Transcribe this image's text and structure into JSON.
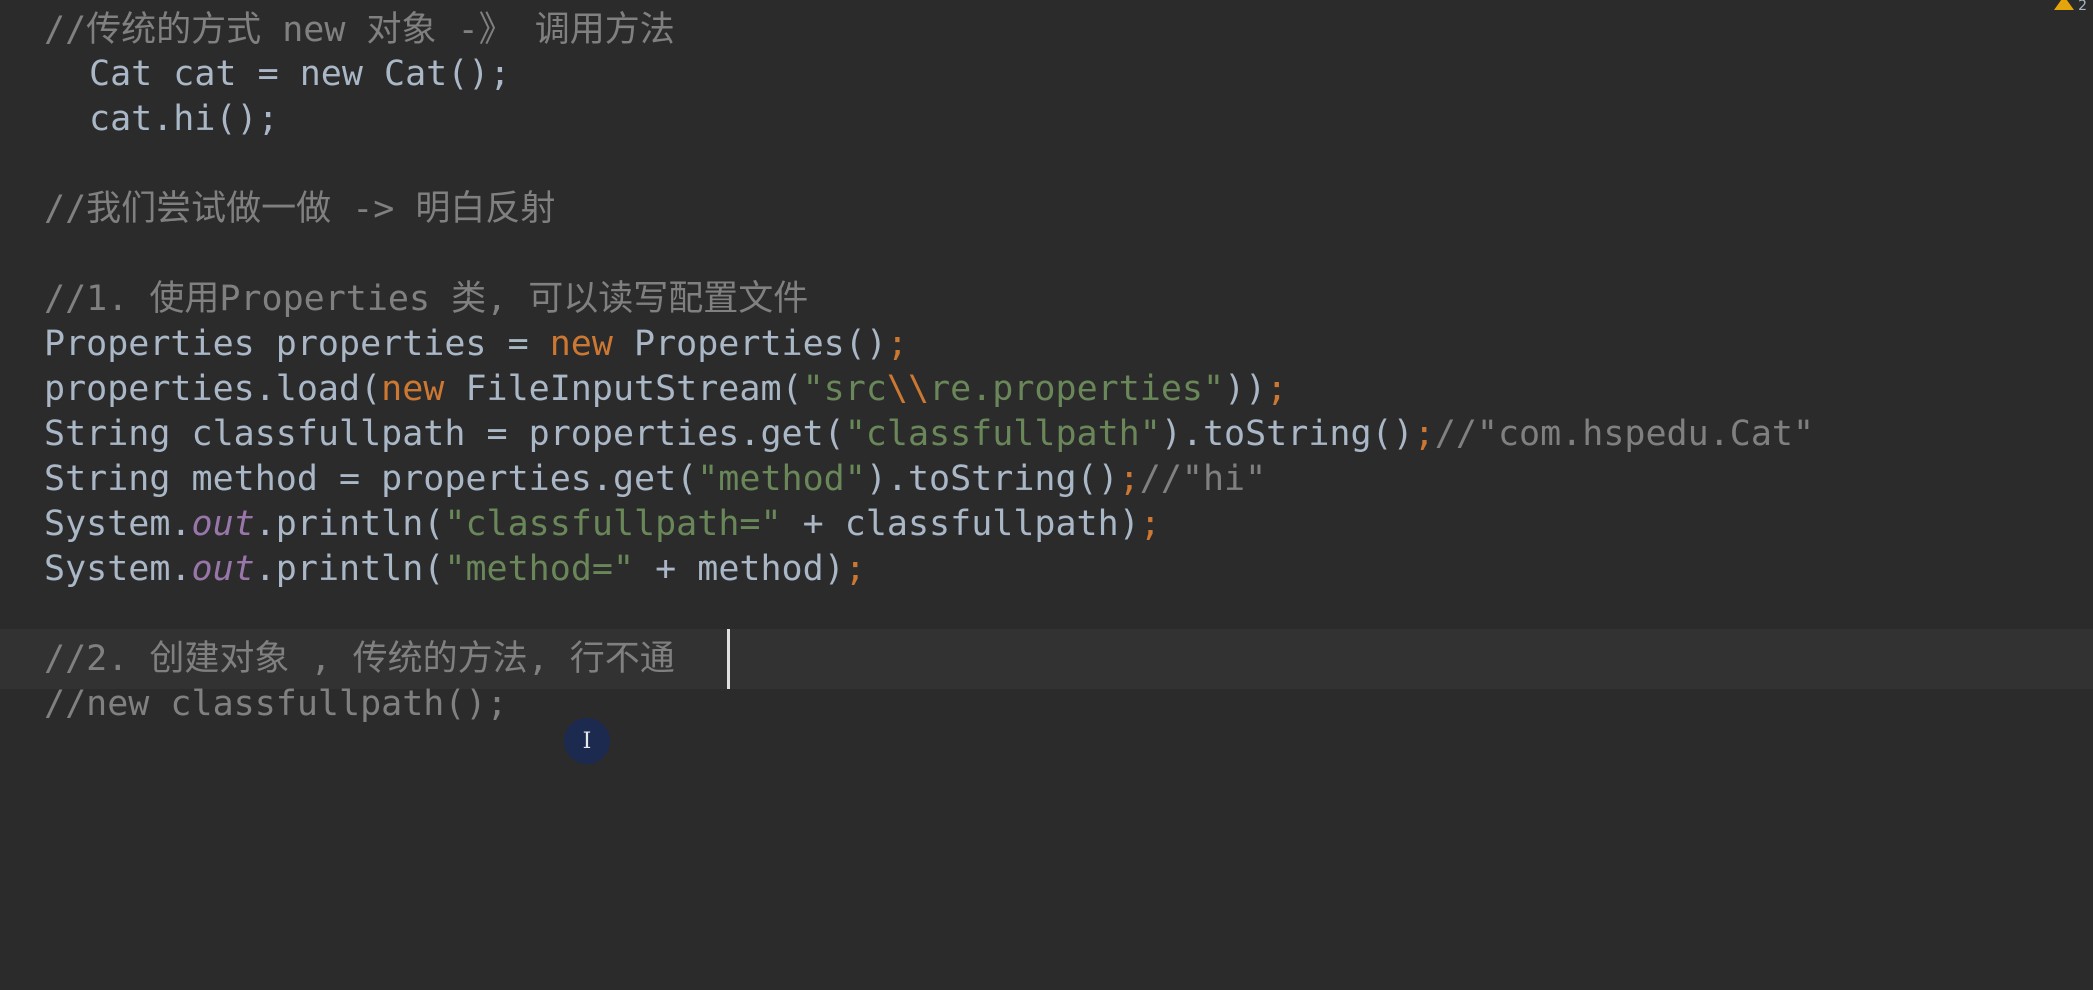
{
  "editor": {
    "warnings": {
      "count": "2"
    },
    "lines": [
      {
        "tokens": [
          {
            "t": "//传统的方式 new 对象 -》 调用方法",
            "c": "comment"
          }
        ]
      },
      {
        "tokens": [
          {
            "t": "Cat cat = new Cat();",
            "c": "plain"
          }
        ]
      },
      {
        "tokens": [
          {
            "t": "cat.hi();",
            "c": "plain"
          }
        ]
      },
      {
        "tokens": []
      },
      {
        "tokens": [
          {
            "t": "//我们尝试做一做 -> 明白反射",
            "c": "comment"
          }
        ]
      },
      {
        "tokens": []
      },
      {
        "tokens": [
          {
            "t": "//1. 使用Properties 类, 可以读写配置文件",
            "c": "comment"
          }
        ]
      },
      {
        "tokens": [
          {
            "t": "Properties properties = ",
            "c": "plain"
          },
          {
            "t": "new",
            "c": "keyword"
          },
          {
            "t": " Properties()",
            "c": "plain"
          },
          {
            "t": ";",
            "c": "keyword"
          }
        ]
      },
      {
        "tokens": [
          {
            "t": "properties.load(",
            "c": "plain"
          },
          {
            "t": "new",
            "c": "keyword"
          },
          {
            "t": " FileInputStream(",
            "c": "plain"
          },
          {
            "t": "\"src",
            "c": "string"
          },
          {
            "t": "\\\\",
            "c": "escape"
          },
          {
            "t": "re.properties\"",
            "c": "string"
          },
          {
            "t": "))",
            "c": "plain"
          },
          {
            "t": ";",
            "c": "keyword"
          }
        ]
      },
      {
        "tokens": [
          {
            "t": "String classfullpath = properties.get(",
            "c": "plain"
          },
          {
            "t": "\"classfullpath\"",
            "c": "string"
          },
          {
            "t": ").toString()",
            "c": "plain"
          },
          {
            "t": ";",
            "c": "keyword"
          },
          {
            "t": "//\"com.hspedu.Cat\"",
            "c": "comment"
          }
        ]
      },
      {
        "tokens": [
          {
            "t": "String method = properties.get(",
            "c": "plain"
          },
          {
            "t": "\"method\"",
            "c": "string"
          },
          {
            "t": ").toString()",
            "c": "plain"
          },
          {
            "t": ";",
            "c": "keyword"
          },
          {
            "t": "//\"hi\"",
            "c": "comment"
          }
        ]
      },
      {
        "tokens": [
          {
            "t": "System.",
            "c": "plain"
          },
          {
            "t": "out",
            "c": "field"
          },
          {
            "t": ".println(",
            "c": "plain"
          },
          {
            "t": "\"classfullpath=\"",
            "c": "string"
          },
          {
            "t": " + classfullpath)",
            "c": "plain"
          },
          {
            "t": ";",
            "c": "keyword"
          }
        ]
      },
      {
        "tokens": [
          {
            "t": "System.",
            "c": "plain"
          },
          {
            "t": "out",
            "c": "field"
          },
          {
            "t": ".println(",
            "c": "plain"
          },
          {
            "t": "\"method=\"",
            "c": "string"
          },
          {
            "t": " + method)",
            "c": "plain"
          },
          {
            "t": ";",
            "c": "keyword"
          }
        ]
      },
      {
        "tokens": []
      },
      {
        "tokens": [
          {
            "t": "//2. 创建对象 , 传统的方法, 行不通",
            "c": "comment"
          }
        ]
      },
      {
        "tokens": [
          {
            "t": "//new classfullpath();",
            "c": "comment"
          }
        ]
      }
    ]
  },
  "theme": {
    "background": "#2b2b2b",
    "current_line": "#323232",
    "comment": "#808080",
    "keyword": "#cc7832",
    "string": "#6a8759",
    "field": "#9876aa",
    "plain": "#a9b7c6",
    "warning": "#e5a50a"
  },
  "icons": {
    "warning": "warning-triangle-icon",
    "mouse_cursor": "text-cursor-icon"
  }
}
